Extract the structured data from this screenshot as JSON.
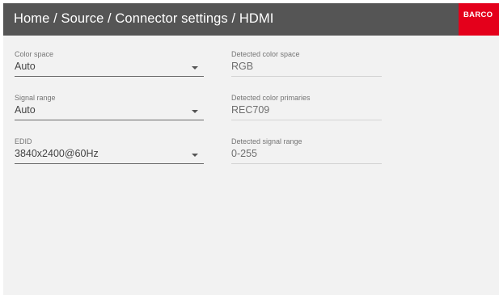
{
  "header": {
    "breadcrumb": "Home / Source / Connector settings / HDMI",
    "logo": "BARCO"
  },
  "settings": [
    {
      "label": "Color space",
      "value": "Auto"
    },
    {
      "label": "Signal range",
      "value": "Auto"
    },
    {
      "label": "EDID",
      "value": "3840x2400@60Hz"
    }
  ],
  "detected": [
    {
      "label": "Detected color space",
      "value": "RGB"
    },
    {
      "label": "Detected color primaries",
      "value": "REC709"
    },
    {
      "label": "Detected signal range",
      "value": "0-255"
    }
  ],
  "icons": {
    "dropdown": "caret-down-icon"
  },
  "colors": {
    "header_bg": "#555555",
    "brand_red": "#e4001b",
    "panel_bg": "#f2f2f2"
  }
}
